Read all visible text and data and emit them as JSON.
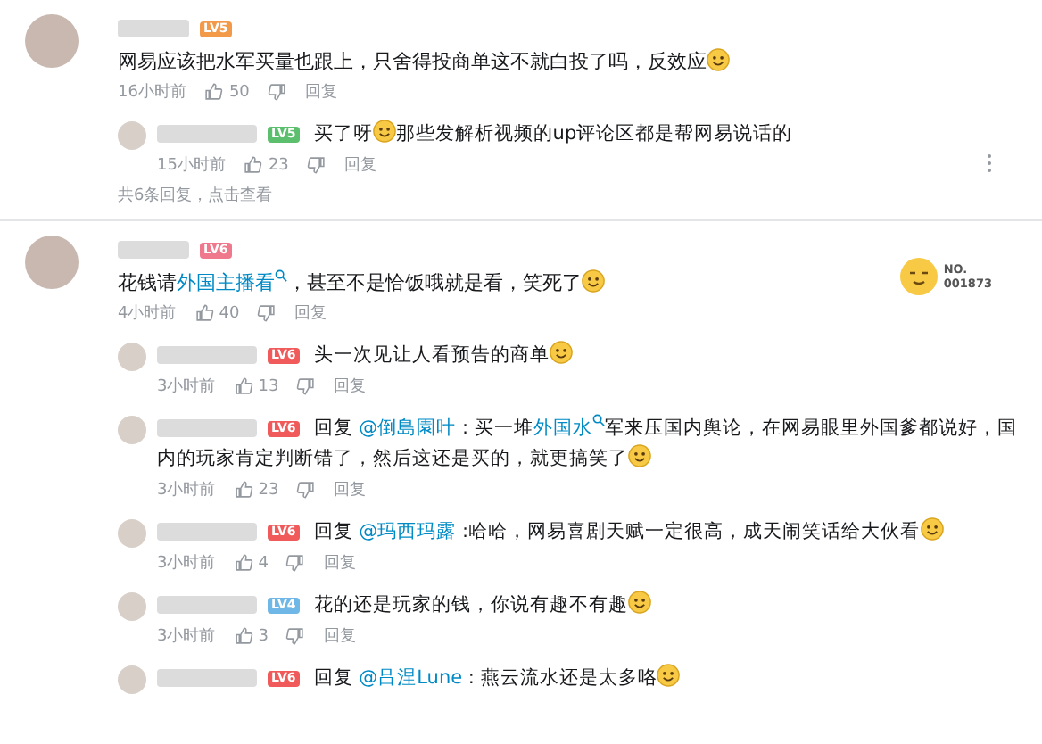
{
  "comments": [
    {
      "level": {
        "text": "LV5",
        "color": "#f29a4a"
      },
      "segments": [
        {
          "kind": "text",
          "text": "网易应该把水军买量也跟上，只舍得投商单这不就白投了吗，反效应"
        },
        {
          "kind": "emoji"
        }
      ],
      "time": "16小时前",
      "likes": "50",
      "reply_label": "回复",
      "replies": [
        {
          "level": {
            "text": "LV5",
            "color": "#5cbf6e"
          },
          "segments": [
            {
              "kind": "text",
              "text": "买了呀"
            },
            {
              "kind": "emoji"
            },
            {
              "kind": "text",
              "text": "那些发解析视频的up评论区都是帮网易说话的"
            }
          ],
          "time": "15小时前",
          "likes": "23",
          "reply_label": "回复",
          "menu_visible": true
        }
      ],
      "more": "共6条回复，点击查看"
    },
    {
      "level": {
        "text": "LV6",
        "color": "#f0788c"
      },
      "fan_badge": {
        "label": "NO.",
        "number": "001873"
      },
      "segments": [
        {
          "kind": "text",
          "text": "花钱请"
        },
        {
          "kind": "search-link",
          "text": "外国主播看"
        },
        {
          "kind": "text",
          "text": "，甚至不是恰饭哦就是看，笑死了"
        },
        {
          "kind": "emoji"
        }
      ],
      "time": "4小时前",
      "likes": "40",
      "reply_label": "回复",
      "replies": [
        {
          "level": {
            "text": "LV6",
            "color": "#f05a5a"
          },
          "segments": [
            {
              "kind": "text",
              "text": "头一次见让人看预告的商单"
            },
            {
              "kind": "emoji"
            }
          ],
          "time": "3小时前",
          "likes": "13",
          "reply_label": "回复",
          "menu_visible": false
        },
        {
          "level": {
            "text": "LV6",
            "color": "#f05a5a"
          },
          "segments": [
            {
              "kind": "text",
              "text": "回复 "
            },
            {
              "kind": "link",
              "text": "@倒島園叶"
            },
            {
              "kind": "text",
              "text": " : 买一堆"
            },
            {
              "kind": "search-link",
              "text": "外国水"
            },
            {
              "kind": "text",
              "text": "军来压国内舆论，在网易眼里外国爹都说好，国内的玩家肯定判断错了，然后这还是买的，就更搞笑了"
            },
            {
              "kind": "emoji"
            }
          ],
          "time": "3小时前",
          "likes": "23",
          "reply_label": "回复",
          "menu_visible": false
        },
        {
          "level": {
            "text": "LV6",
            "color": "#f05a5a"
          },
          "segments": [
            {
              "kind": "text",
              "text": "回复 "
            },
            {
              "kind": "link",
              "text": "@玛西玛露"
            },
            {
              "kind": "text",
              "text": " :哈哈，网易喜剧天赋一定很高，成天闹笑话给大伙看"
            },
            {
              "kind": "emoji"
            }
          ],
          "time": "3小时前",
          "likes": "4",
          "reply_label": "回复",
          "menu_visible": false
        },
        {
          "level": {
            "text": "LV4",
            "color": "#6fb7e6"
          },
          "segments": [
            {
              "kind": "text",
              "text": "花的还是玩家的钱，你说有趣不有趣"
            },
            {
              "kind": "emoji"
            }
          ],
          "time": "3小时前",
          "likes": "3",
          "reply_label": "回复",
          "menu_visible": false
        },
        {
          "level": {
            "text": "LV6",
            "color": "#f05a5a"
          },
          "segments": [
            {
              "kind": "text",
              "text": "回复 "
            },
            {
              "kind": "link",
              "text": "@吕涅Lune"
            },
            {
              "kind": "text",
              "text": " : 燕云流水还是太多咯"
            },
            {
              "kind": "emoji"
            }
          ],
          "menu_visible": false
        }
      ]
    }
  ]
}
